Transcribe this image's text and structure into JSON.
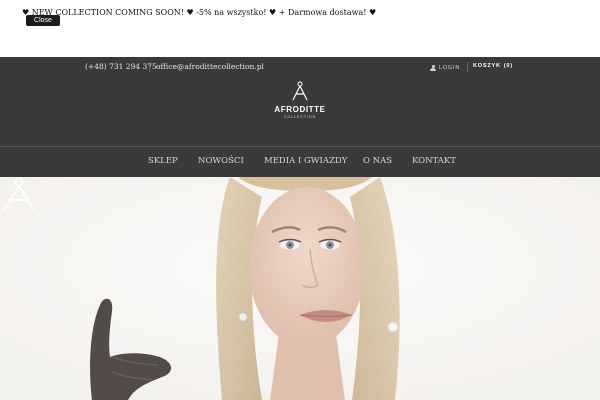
{
  "announcement": {
    "text": "♥ NEW COLLECTION COMING SOON! ♥ -5% na wszystko! ♥ + Darmowa dostawa! ♥",
    "close_label": "Close"
  },
  "header": {
    "phone": "(+48) 731 294 375",
    "email": "office@afrodittecollection.pl",
    "login_label": "LOGIN",
    "login_icon": "user-icon",
    "cart_label": "KOSZYK",
    "cart_count": "(0)"
  },
  "logo": {
    "title": "AFRODITTE",
    "subtitle": "COLLECTION"
  },
  "nav": {
    "items": [
      "SKLEP",
      "NOWOŚCI",
      "MEDIA I GWIAZDY",
      "O NAS",
      "KONTAKT"
    ]
  },
  "colors": {
    "header_bg": "#3a3a3a",
    "announce_bg": "#ffffff",
    "close_bg": "#1b1b1b",
    "nav_text": "#d8d8d8"
  }
}
